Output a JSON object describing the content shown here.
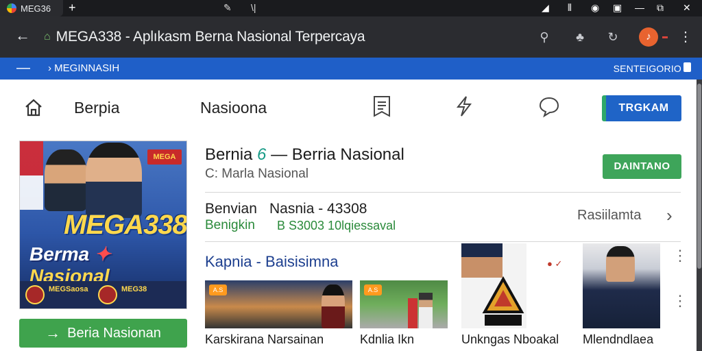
{
  "browser": {
    "tab_title": "MEG36",
    "new_tab": "+",
    "address": "MEGA338 - Aplıkasm Berna Nasional Terpercaya"
  },
  "bookmarks": {
    "crumb": "MEGINNASIH",
    "right": "SENTEIGORIO"
  },
  "nav": {
    "item1": "Berpia",
    "item2": "Nasioona",
    "cta": "TRGKAM"
  },
  "banner": {
    "brand": "MEGA338",
    "tag_left": "Berma",
    "tag_right": "Nasional",
    "badge": "MEGA",
    "foot_left": "MEGSaosa",
    "foot_right": "MEG38"
  },
  "cta_button": {
    "label": "Beria Nasionan",
    "arrow": "→"
  },
  "article": {
    "title_prefix": "Bernia",
    "title_num": "6",
    "title_rest": " — Berria Nasional",
    "subtitle": "C:  Marla Nasional",
    "download": "DAINTANO"
  },
  "info": {
    "label1": "Benvian",
    "value1": "Nasnia - 43308",
    "label2": "Benigkin",
    "value2": "B S3003 10lqiessaval",
    "link": "Rasiilamta",
    "chevron": "›"
  },
  "section": {
    "title": "Kapnia - Baisisimna"
  },
  "cards": [
    {
      "caption": "Karskirana Narsainan",
      "tag": "A.S"
    },
    {
      "caption": "Kdnlia Ikn",
      "tag": "A.S"
    },
    {
      "caption": "Unkngas Nboakal"
    },
    {
      "caption": "Mlendndlaea"
    }
  ],
  "colors": {
    "accent_blue": "#1f64c7",
    "accent_green": "#3fa34d",
    "bookmark_bar": "#1f5fc8"
  }
}
